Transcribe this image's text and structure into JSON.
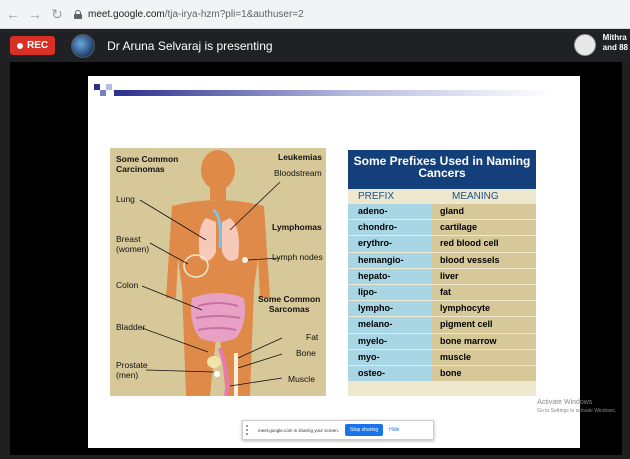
{
  "browser": {
    "url_host": "meet.google.com",
    "url_path": "/tja-irya-hzm?pli=1&authuser=2"
  },
  "meet": {
    "rec_label": "REC",
    "presenting_text": "Dr Aruna Selvaraj is presenting",
    "participant_text_line1": "Mithra",
    "participant_text_line2": "and 88"
  },
  "diagram": {
    "common_carcinomas": "Some Common\nCarcinomas",
    "leukemias": "Leukemias",
    "bloodstream": "Bloodstream",
    "lung": "Lung",
    "lymphomas": "Lymphomas",
    "breast": "Breast\n(women)",
    "lymph_nodes": "Lymph nodes",
    "colon": "Colon",
    "common_sarcomas": "Some Common\nSarcomas",
    "bladder": "Bladder",
    "fat": "Fat",
    "bone": "Bone",
    "prostate": "Prostate\n(men)",
    "muscle": "Muscle"
  },
  "prefix_table": {
    "title": "Some Prefixes Used in Naming Cancers",
    "col_prefix": "PREFIX",
    "col_meaning": "MEANING",
    "rows": [
      {
        "prefix": "adeno-",
        "meaning": "gland"
      },
      {
        "prefix": "chondro-",
        "meaning": "cartilage"
      },
      {
        "prefix": "erythro-",
        "meaning": "red blood cell"
      },
      {
        "prefix": "hemangio-",
        "meaning": "blood vessels"
      },
      {
        "prefix": "hepato-",
        "meaning": "liver"
      },
      {
        "prefix": "lipo-",
        "meaning": "fat"
      },
      {
        "prefix": "lympho-",
        "meaning": "lymphocyte"
      },
      {
        "prefix": "melano-",
        "meaning": "pigment cell"
      },
      {
        "prefix": "myelo-",
        "meaning": "bone marrow"
      },
      {
        "prefix": "myo-",
        "meaning": "muscle"
      },
      {
        "prefix": "osteo-",
        "meaning": "bone"
      }
    ]
  },
  "share_bar": {
    "text": "meet.google.com is sharing your screen.",
    "stop_label": "Stop sharing",
    "hide_label": "Hide"
  },
  "watermark": {
    "line1": "Activate Windows",
    "line2": "Go to Settings to activate Windows."
  },
  "colors": {
    "rec": "#d93025",
    "table_header": "#13407a",
    "prefix_cell": "#a9d6e5",
    "meaning_cell": "#d7c89a"
  }
}
